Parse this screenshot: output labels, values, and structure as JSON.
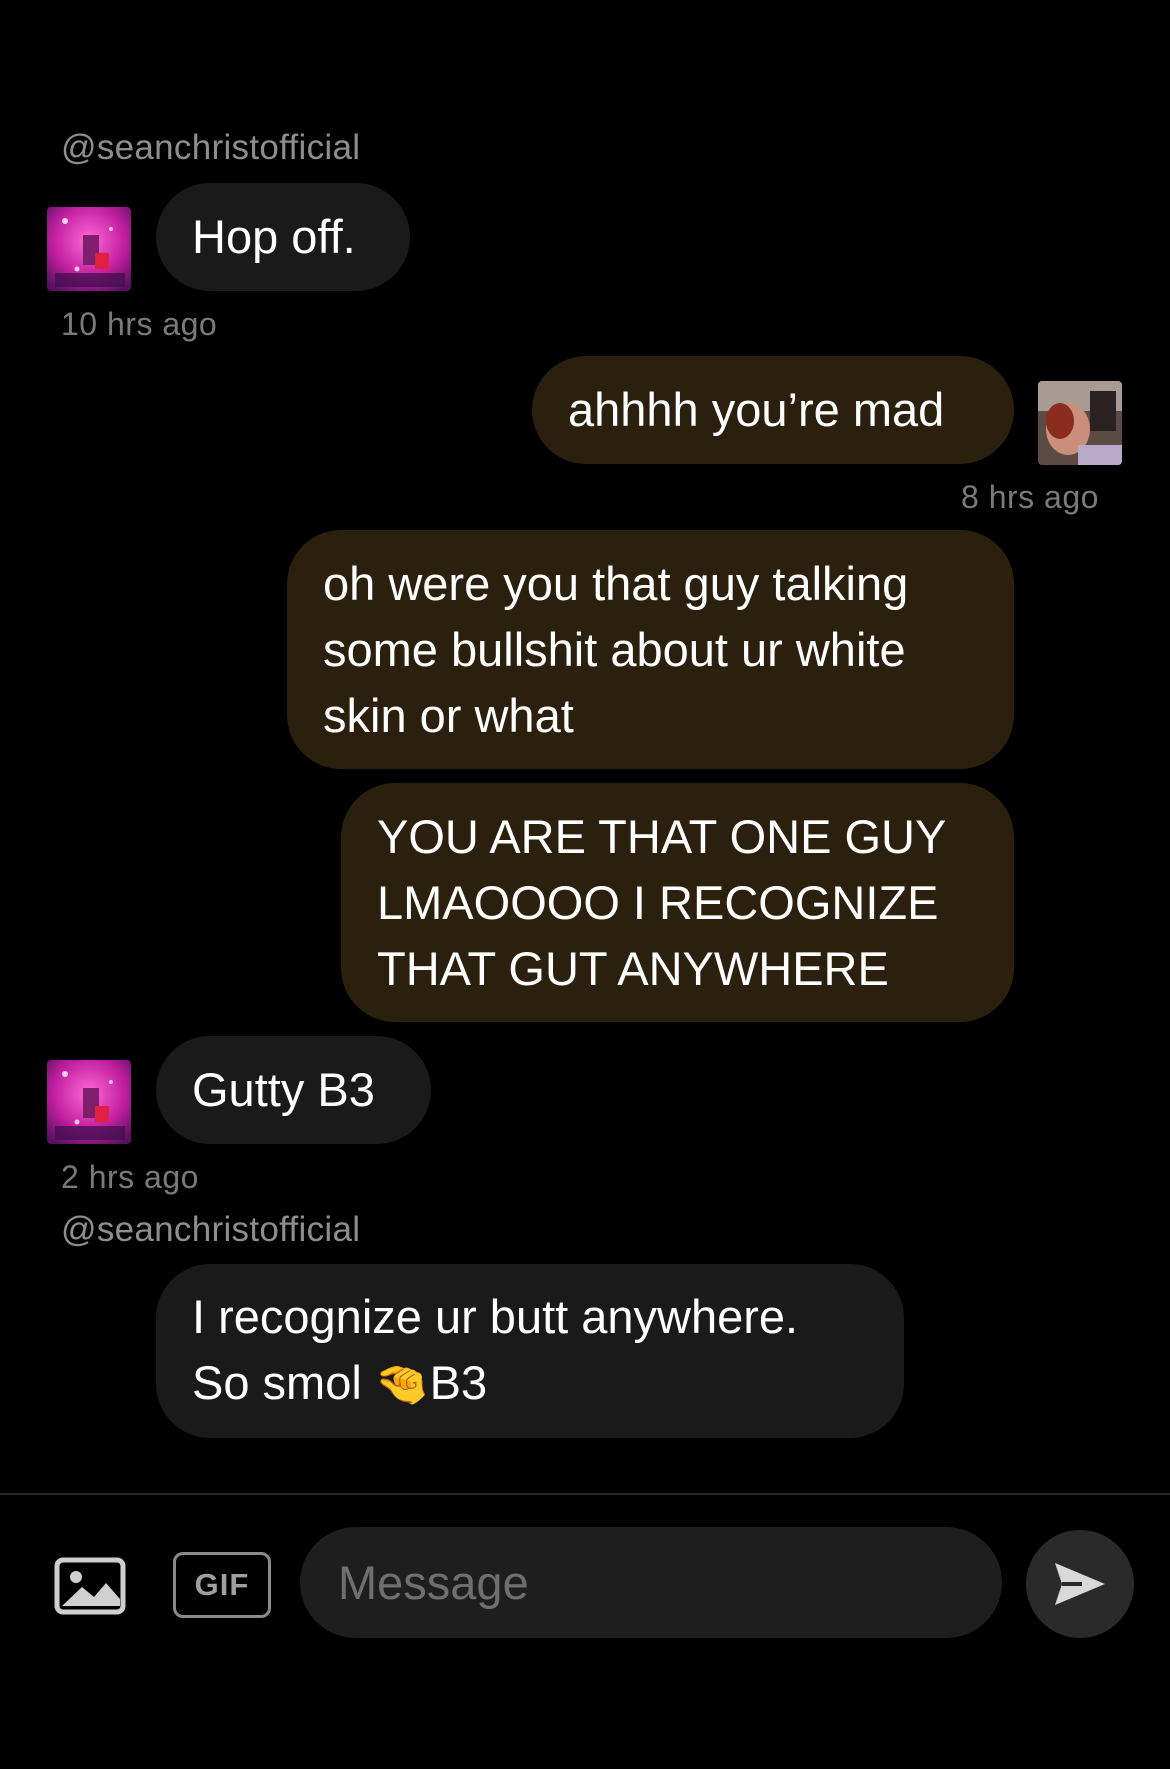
{
  "thread": [
    {
      "type": "username",
      "text": "@seanchristofficial"
    },
    {
      "type": "incoming",
      "lines": [
        "Hop off."
      ],
      "timestamp": "10 hrs ago",
      "avatar": "pink-glitter-avatar"
    },
    {
      "type": "outgoing",
      "lines": [
        "ahhhh you’re mad"
      ],
      "timestamp": "8 hrs ago",
      "avatar": "user-photo-avatar"
    },
    {
      "type": "outgoing",
      "lines": [
        "oh were you that guy talking",
        "some bullshit about ur white",
        "skin or what"
      ]
    },
    {
      "type": "outgoing",
      "lines": [
        "YOU ARE THAT ONE GUY",
        "LMAOOOO I RECOGNIZE",
        "THAT GUT ANYWHERE"
      ]
    },
    {
      "type": "incoming",
      "lines": [
        "Gutty B3"
      ],
      "timestamp": "2 hrs ago",
      "avatar": "pink-glitter-avatar"
    },
    {
      "type": "username",
      "text": "@seanchristofficial"
    },
    {
      "type": "incoming",
      "lines": [
        "I recognize ur butt anywhere.",
        "So smol",
        "🤏",
        "B3"
      ]
    }
  ],
  "composer": {
    "image_button_icon": "image-icon",
    "gif_label": "GIF",
    "placeholder": "Message",
    "value": "",
    "send_icon": "send-icon"
  },
  "colors": {
    "background": "#000000",
    "incoming_bubble": "#1a1a1a",
    "outgoing_bubble": "#2a200d",
    "muted_text": "#8e8e8e"
  }
}
